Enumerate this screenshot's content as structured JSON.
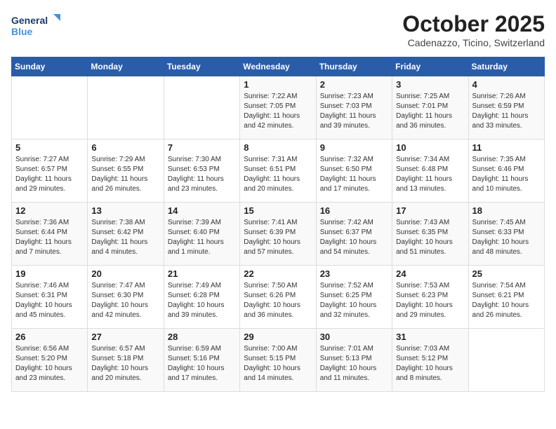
{
  "header": {
    "logo_line1": "General",
    "logo_line2": "Blue",
    "month": "October 2025",
    "location": "Cadenazzo, Ticino, Switzerland"
  },
  "weekdays": [
    "Sunday",
    "Monday",
    "Tuesday",
    "Wednesday",
    "Thursday",
    "Friday",
    "Saturday"
  ],
  "weeks": [
    [
      {
        "day": "",
        "sunrise": "",
        "sunset": "",
        "daylight": ""
      },
      {
        "day": "",
        "sunrise": "",
        "sunset": "",
        "daylight": ""
      },
      {
        "day": "",
        "sunrise": "",
        "sunset": "",
        "daylight": ""
      },
      {
        "day": "1",
        "sunrise": "Sunrise: 7:22 AM",
        "sunset": "Sunset: 7:05 PM",
        "daylight": "Daylight: 11 hours and 42 minutes."
      },
      {
        "day": "2",
        "sunrise": "Sunrise: 7:23 AM",
        "sunset": "Sunset: 7:03 PM",
        "daylight": "Daylight: 11 hours and 39 minutes."
      },
      {
        "day": "3",
        "sunrise": "Sunrise: 7:25 AM",
        "sunset": "Sunset: 7:01 PM",
        "daylight": "Daylight: 11 hours and 36 minutes."
      },
      {
        "day": "4",
        "sunrise": "Sunrise: 7:26 AM",
        "sunset": "Sunset: 6:59 PM",
        "daylight": "Daylight: 11 hours and 33 minutes."
      }
    ],
    [
      {
        "day": "5",
        "sunrise": "Sunrise: 7:27 AM",
        "sunset": "Sunset: 6:57 PM",
        "daylight": "Daylight: 11 hours and 29 minutes."
      },
      {
        "day": "6",
        "sunrise": "Sunrise: 7:29 AM",
        "sunset": "Sunset: 6:55 PM",
        "daylight": "Daylight: 11 hours and 26 minutes."
      },
      {
        "day": "7",
        "sunrise": "Sunrise: 7:30 AM",
        "sunset": "Sunset: 6:53 PM",
        "daylight": "Daylight: 11 hours and 23 minutes."
      },
      {
        "day": "8",
        "sunrise": "Sunrise: 7:31 AM",
        "sunset": "Sunset: 6:51 PM",
        "daylight": "Daylight: 11 hours and 20 minutes."
      },
      {
        "day": "9",
        "sunrise": "Sunrise: 7:32 AM",
        "sunset": "Sunset: 6:50 PM",
        "daylight": "Daylight: 11 hours and 17 minutes."
      },
      {
        "day": "10",
        "sunrise": "Sunrise: 7:34 AM",
        "sunset": "Sunset: 6:48 PM",
        "daylight": "Daylight: 11 hours and 13 minutes."
      },
      {
        "day": "11",
        "sunrise": "Sunrise: 7:35 AM",
        "sunset": "Sunset: 6:46 PM",
        "daylight": "Daylight: 11 hours and 10 minutes."
      }
    ],
    [
      {
        "day": "12",
        "sunrise": "Sunrise: 7:36 AM",
        "sunset": "Sunset: 6:44 PM",
        "daylight": "Daylight: 11 hours and 7 minutes."
      },
      {
        "day": "13",
        "sunrise": "Sunrise: 7:38 AM",
        "sunset": "Sunset: 6:42 PM",
        "daylight": "Daylight: 11 hours and 4 minutes."
      },
      {
        "day": "14",
        "sunrise": "Sunrise: 7:39 AM",
        "sunset": "Sunset: 6:40 PM",
        "daylight": "Daylight: 11 hours and 1 minute."
      },
      {
        "day": "15",
        "sunrise": "Sunrise: 7:41 AM",
        "sunset": "Sunset: 6:39 PM",
        "daylight": "Daylight: 10 hours and 57 minutes."
      },
      {
        "day": "16",
        "sunrise": "Sunrise: 7:42 AM",
        "sunset": "Sunset: 6:37 PM",
        "daylight": "Daylight: 10 hours and 54 minutes."
      },
      {
        "day": "17",
        "sunrise": "Sunrise: 7:43 AM",
        "sunset": "Sunset: 6:35 PM",
        "daylight": "Daylight: 10 hours and 51 minutes."
      },
      {
        "day": "18",
        "sunrise": "Sunrise: 7:45 AM",
        "sunset": "Sunset: 6:33 PM",
        "daylight": "Daylight: 10 hours and 48 minutes."
      }
    ],
    [
      {
        "day": "19",
        "sunrise": "Sunrise: 7:46 AM",
        "sunset": "Sunset: 6:31 PM",
        "daylight": "Daylight: 10 hours and 45 minutes."
      },
      {
        "day": "20",
        "sunrise": "Sunrise: 7:47 AM",
        "sunset": "Sunset: 6:30 PM",
        "daylight": "Daylight: 10 hours and 42 minutes."
      },
      {
        "day": "21",
        "sunrise": "Sunrise: 7:49 AM",
        "sunset": "Sunset: 6:28 PM",
        "daylight": "Daylight: 10 hours and 39 minutes."
      },
      {
        "day": "22",
        "sunrise": "Sunrise: 7:50 AM",
        "sunset": "Sunset: 6:26 PM",
        "daylight": "Daylight: 10 hours and 36 minutes."
      },
      {
        "day": "23",
        "sunrise": "Sunrise: 7:52 AM",
        "sunset": "Sunset: 6:25 PM",
        "daylight": "Daylight: 10 hours and 32 minutes."
      },
      {
        "day": "24",
        "sunrise": "Sunrise: 7:53 AM",
        "sunset": "Sunset: 6:23 PM",
        "daylight": "Daylight: 10 hours and 29 minutes."
      },
      {
        "day": "25",
        "sunrise": "Sunrise: 7:54 AM",
        "sunset": "Sunset: 6:21 PM",
        "daylight": "Daylight: 10 hours and 26 minutes."
      }
    ],
    [
      {
        "day": "26",
        "sunrise": "Sunrise: 6:56 AM",
        "sunset": "Sunset: 5:20 PM",
        "daylight": "Daylight: 10 hours and 23 minutes."
      },
      {
        "day": "27",
        "sunrise": "Sunrise: 6:57 AM",
        "sunset": "Sunset: 5:18 PM",
        "daylight": "Daylight: 10 hours and 20 minutes."
      },
      {
        "day": "28",
        "sunrise": "Sunrise: 6:59 AM",
        "sunset": "Sunset: 5:16 PM",
        "daylight": "Daylight: 10 hours and 17 minutes."
      },
      {
        "day": "29",
        "sunrise": "Sunrise: 7:00 AM",
        "sunset": "Sunset: 5:15 PM",
        "daylight": "Daylight: 10 hours and 14 minutes."
      },
      {
        "day": "30",
        "sunrise": "Sunrise: 7:01 AM",
        "sunset": "Sunset: 5:13 PM",
        "daylight": "Daylight: 10 hours and 11 minutes."
      },
      {
        "day": "31",
        "sunrise": "Sunrise: 7:03 AM",
        "sunset": "Sunset: 5:12 PM",
        "daylight": "Daylight: 10 hours and 8 minutes."
      },
      {
        "day": "",
        "sunrise": "",
        "sunset": "",
        "daylight": ""
      }
    ]
  ]
}
